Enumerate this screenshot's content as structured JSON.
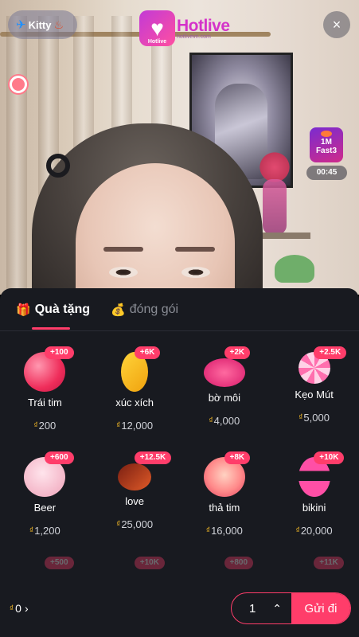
{
  "stream": {
    "username": "Kitty",
    "user_badge_icon": "flame-badge-icon",
    "logo_name": "Hotlive",
    "logo_sub": "Hotlive",
    "logo_url": "hotlivevn.com",
    "game_label_line1": "1M",
    "game_label_line2": "Fast3",
    "game_timer": "00:45",
    "close_icon": "×"
  },
  "panel": {
    "tabs": [
      {
        "label": "Quà tặng",
        "active": true,
        "icon": "gift-icon"
      },
      {
        "label": "đóng gói",
        "active": false,
        "icon": "bag-icon"
      }
    ],
    "currency_symbol": "₫",
    "gifts": [
      {
        "name": "Trái tim",
        "price": "200",
        "bonus": "+100",
        "art": "heart"
      },
      {
        "name": "xúc xích",
        "price": "12,000",
        "bonus": "+6K",
        "art": "sausage"
      },
      {
        "name": "bờ môi",
        "price": "4,000",
        "bonus": "+2K",
        "art": "lips"
      },
      {
        "name": "Kẹo Mút",
        "price": "5,000",
        "bonus": "+2.5K",
        "art": "lollipop"
      },
      {
        "name": "Beer",
        "price": "1,200",
        "bonus": "+600",
        "art": "bear"
      },
      {
        "name": "love",
        "price": "25,000",
        "bonus": "+12.5K",
        "art": "love-sign"
      },
      {
        "name": "thả tim",
        "price": "16,000",
        "bonus": "+8K",
        "art": "heart-hand"
      },
      {
        "name": "bikini",
        "price": "20,000",
        "bonus": "+10K",
        "art": "bikini"
      }
    ],
    "partial_row_bonuses": [
      "+500",
      "+10K",
      "+800",
      "+11K"
    ]
  },
  "footer": {
    "balance": "0",
    "quantity": "1",
    "send_label": "Gửi đi"
  }
}
